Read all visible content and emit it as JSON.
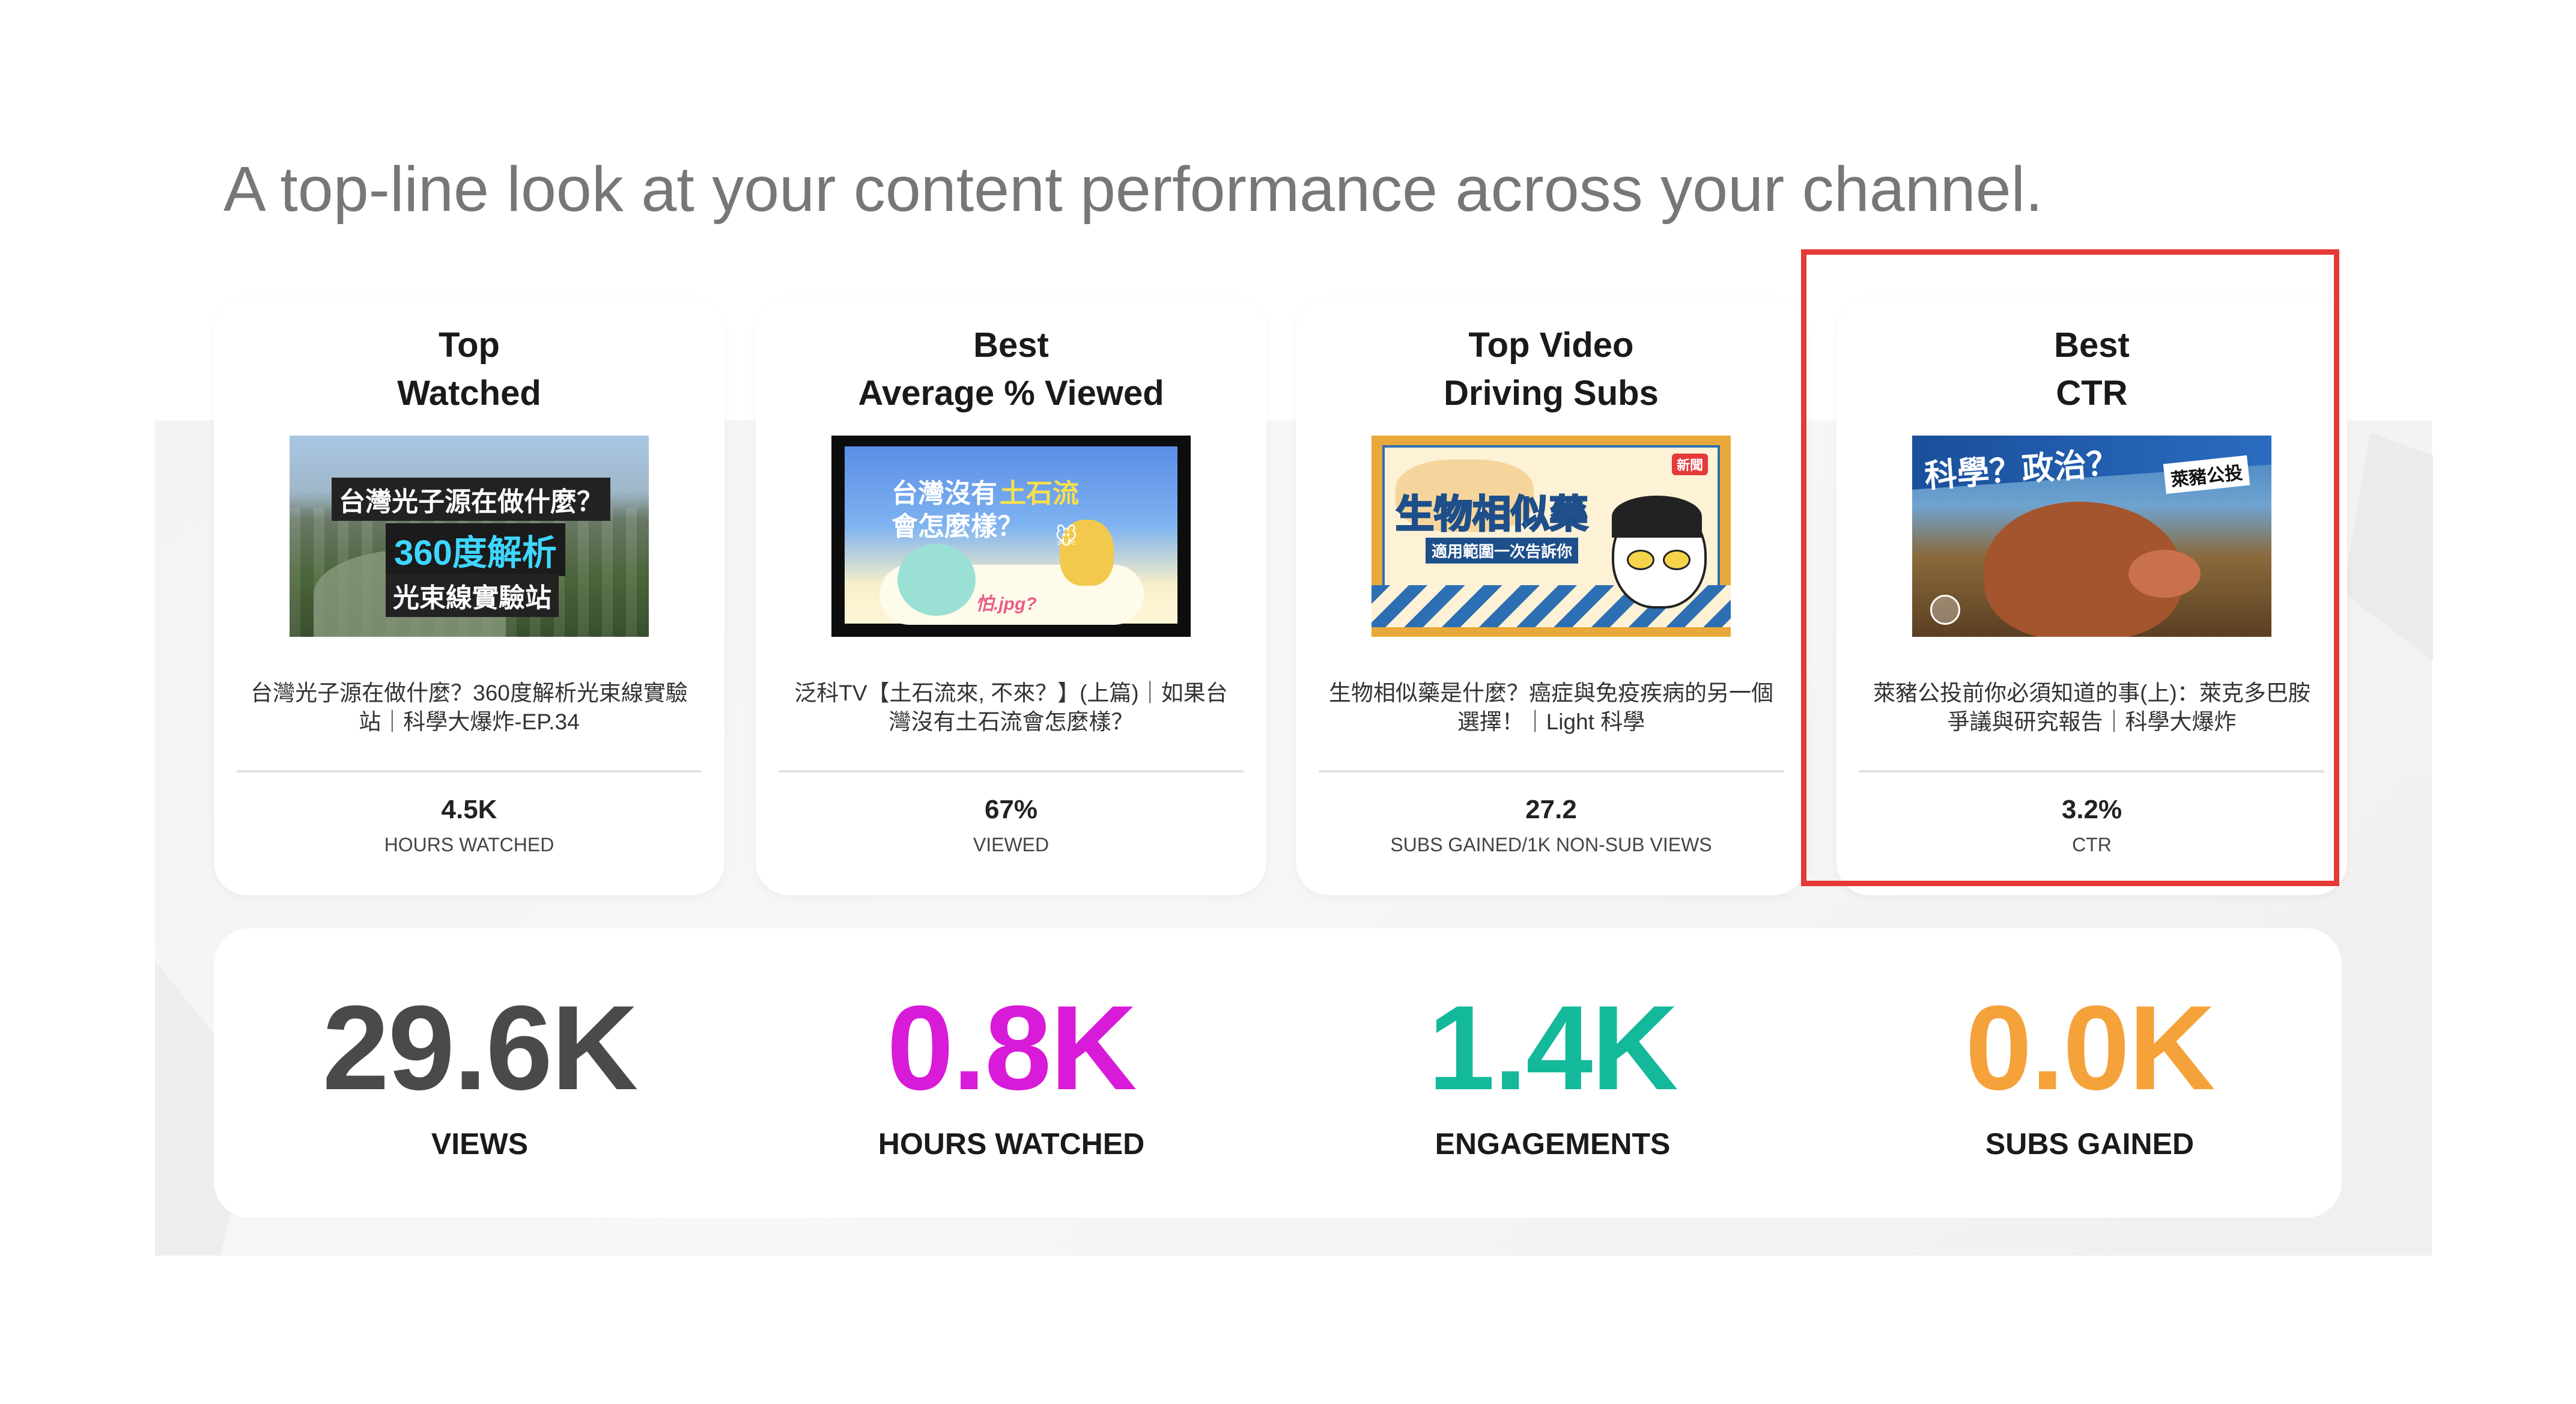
{
  "headline": "A top-line look at your content performance across your channel.",
  "cards": [
    {
      "title_line1": "Top",
      "title_line2": "Watched",
      "thumb_text": [
        "台灣光子源在做什麼？",
        "360度解析",
        "光束線實驗站"
      ],
      "video_title": "台灣光子源在做什麼？360度解析光束線實驗站｜科學大爆炸-EP.34",
      "value": "4.5K",
      "label": "HOURS WATCHED"
    },
    {
      "title_line1": "Best",
      "title_line2": "Average % Viewed",
      "thumb_text": [
        "台灣沒有",
        "土石流",
        "會怎麼樣？",
        "怕.jpg?"
      ],
      "video_title": "泛科TV【土石流來, 不來？】(上篇)｜如果台灣沒有土石流會怎麼樣？",
      "value": "67%",
      "label": "VIEWED"
    },
    {
      "title_line1": "Top Video",
      "title_line2": "Driving Subs",
      "thumb_text": [
        "生物相似藥",
        "適用範圍一次告訴你",
        "新聞"
      ],
      "video_title": "生物相似藥是什麼？癌症與免疫疾病的另一個選擇！｜Light 科學",
      "value": "27.2",
      "label": "SUBS GAINED/1K NON-SUB VIEWS"
    },
    {
      "title_line1": "Best",
      "title_line2": "CTR",
      "thumb_text": [
        "科學？政治？",
        "萊豬公投"
      ],
      "video_title": "萊豬公投前你必須知道的事(上)：萊克多巴胺爭議與研究報告｜科學大爆炸",
      "value": "3.2%",
      "label": "CTR"
    }
  ],
  "stats": [
    {
      "value": "29.6K",
      "label": "VIEWS",
      "color": "#4a4a4a"
    },
    {
      "value": "0.8K",
      "label": "HOURS WATCHED",
      "color": "#d81bd8"
    },
    {
      "value": "1.4K",
      "label": "ENGAGEMENTS",
      "color": "#14b89a"
    },
    {
      "value": "0.0K",
      "label": "SUBS GAINED",
      "color": "#f5a23a"
    }
  ],
  "highlight_color": "#e53935"
}
